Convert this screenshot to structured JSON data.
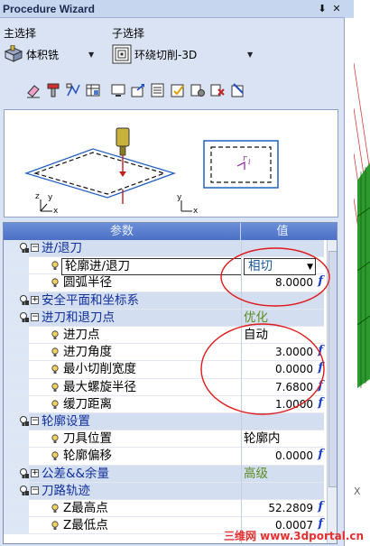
{
  "window": {
    "title": "Procedure Wizard",
    "pin_glyph": "⬇",
    "close_glyph": "✕"
  },
  "main_select": {
    "label": "主选择",
    "value": "体积铣"
  },
  "sub_select": {
    "label": "子选择",
    "value": "环绕切削-3D"
  },
  "grid": {
    "col_param": "参数",
    "col_value": "值",
    "rows": [
      {
        "type": "group",
        "expanded": "⊟",
        "name": "进/退刀",
        "value": ""
      },
      {
        "type": "child",
        "name": "轮廓进/退刀",
        "value": "相切",
        "dropdown": true
      },
      {
        "type": "child",
        "name": "圆弧半径",
        "num": "8.0000",
        "fx": "f"
      },
      {
        "type": "group",
        "expanded": "⊞",
        "name": "安全平面和坐标系",
        "value": ""
      },
      {
        "type": "group",
        "expanded": "⊟",
        "name": "进刀和退刀点",
        "value": "优化"
      },
      {
        "type": "child",
        "name": "进刀点",
        "value": "自动"
      },
      {
        "type": "child",
        "name": "进刀角度",
        "num": "3.0000",
        "fx": "f"
      },
      {
        "type": "child",
        "name": "最小切削宽度",
        "num": "0.0000",
        "fx": "f"
      },
      {
        "type": "child",
        "name": "最大螺旋半径",
        "num": "7.6800",
        "fx": "f"
      },
      {
        "type": "child",
        "name": "缓刀距离",
        "num": "1.0000",
        "fx": "f"
      },
      {
        "type": "group",
        "expanded": "⊟",
        "name": "轮廓设置",
        "value": ""
      },
      {
        "type": "child",
        "name": "刀具位置",
        "value": "轮廓内"
      },
      {
        "type": "child",
        "name": "轮廓偏移",
        "num": "0.0000",
        "fx": "f"
      },
      {
        "type": "group",
        "expanded": "⊞",
        "name": "公差&&余量",
        "value": "高级"
      },
      {
        "type": "group",
        "expanded": "⊟",
        "name": "刀路轨迹",
        "value": ""
      },
      {
        "type": "child",
        "name": "Z最高点",
        "num": "52.2809",
        "fx": "f"
      },
      {
        "type": "child",
        "name": "Z最低点",
        "num": "0.0007",
        "fx": "f"
      }
    ]
  },
  "preview": {
    "axis_x": "x",
    "axis_y": "y",
    "axis_z": "z",
    "marker_r": "r",
    "marker_i": "i"
  },
  "watermark": "三维网 www.3dportal.cn",
  "colors": {
    "accent": "#4b6fc4",
    "group_text": "#10309a",
    "annotation": "#e01818",
    "fx": "#1a3ec9"
  }
}
